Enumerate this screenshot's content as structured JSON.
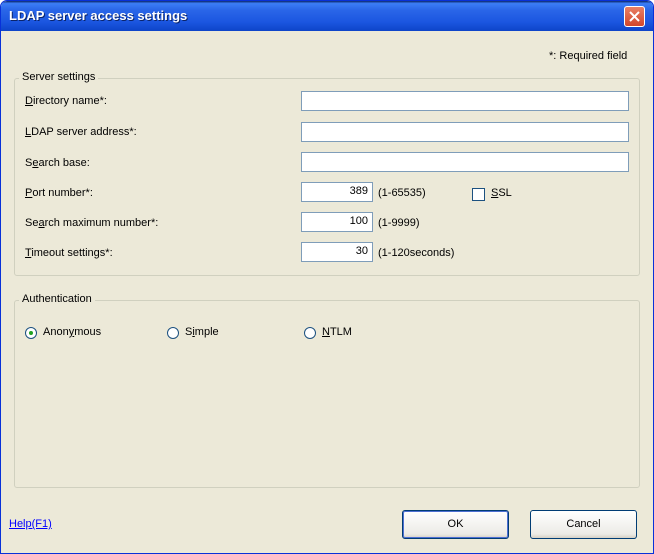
{
  "window": {
    "title": "LDAP server access settings"
  },
  "required_note": "*: Required field",
  "server_settings": {
    "legend": "Server settings",
    "directory_name": {
      "label_ul": "D",
      "label_rest": "irectory name*:",
      "value": ""
    },
    "ldap_address": {
      "label_ul": "L",
      "label_rest": "DAP server address*:",
      "value": ""
    },
    "search_base": {
      "label_pre": "S",
      "label_ul": "e",
      "label_rest": "arch base:",
      "value": ""
    },
    "port": {
      "label_ul": "P",
      "label_rest": "ort number*:",
      "value": "389",
      "range": "(1-65535)"
    },
    "ssl": {
      "label_ul": "S",
      "label_rest": "SL",
      "checked": false
    },
    "search_max": {
      "label_pre": "Se",
      "label_ul": "a",
      "label_rest": "rch maximum number*:",
      "value": "100",
      "range": "(1-9999)"
    },
    "timeout": {
      "label_ul": "T",
      "label_rest": "imeout settings*:",
      "value": "30",
      "range": "(1-120seconds)"
    }
  },
  "authentication": {
    "legend": "Authentication",
    "anonymous": {
      "label_pre": "Anon",
      "label_ul": "y",
      "label_rest": "mous",
      "selected": true
    },
    "simple": {
      "label_pre": "S",
      "label_ul": "i",
      "label_rest": "mple",
      "selected": false
    },
    "ntlm": {
      "label_ul": "N",
      "label_rest": "TLM",
      "selected": false
    }
  },
  "footer": {
    "help": "Help(F1)",
    "ok": "OK",
    "cancel": "Cancel"
  },
  "colors": {
    "title_bar": "#2a66e8",
    "dialog_bg": "#ece9d8",
    "link": "#0000ff",
    "close_button": "#d2462a"
  }
}
